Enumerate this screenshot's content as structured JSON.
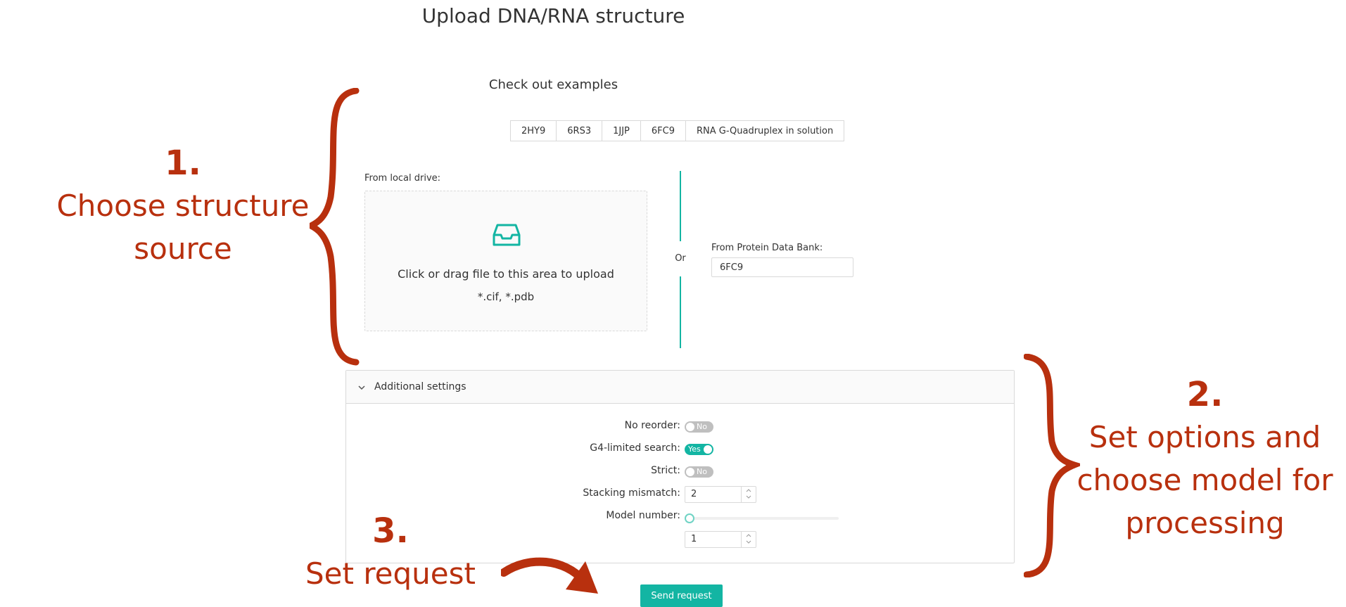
{
  "page": {
    "title": "Upload DNA/RNA structure"
  },
  "examples": {
    "title": "Check out examples",
    "buttons": [
      "2HY9",
      "6RS3",
      "1JJP",
      "6FC9",
      "RNA G-Quadruplex in solution"
    ]
  },
  "upload": {
    "local_label": "From local drive:",
    "drop_text": "Click or drag file to this area to upload",
    "drop_hint": "*.cif, *.pdb",
    "or_label": "Or",
    "pdb_label": "From Protein Data Bank:",
    "pdb_value": "6FC9",
    "icon": "inbox-icon"
  },
  "settings": {
    "title": "Additional settings",
    "no_reorder": {
      "label": "No reorder:",
      "state": "No"
    },
    "g4_limited": {
      "label": "G4-limited search:",
      "state": "Yes"
    },
    "strict": {
      "label": "Strict:",
      "state": "No"
    },
    "stacking_mismatch": {
      "label": "Stacking mismatch:",
      "value": "2"
    },
    "model_number": {
      "label": "Model number:",
      "value": "1",
      "slider_fraction": 0
    }
  },
  "actions": {
    "send_label": "Send request"
  },
  "annotations": {
    "step1": {
      "number": "1.",
      "lines": [
        "Choose structure",
        "source"
      ]
    },
    "step2": {
      "number": "2.",
      "lines": [
        "Set options and",
        "choose model for",
        "processing"
      ]
    },
    "step3": {
      "number": "3.",
      "lines": [
        "Set request"
      ]
    }
  },
  "colors": {
    "accent": "#13b5a3",
    "annotation": "#b8300e",
    "border": "#d9d9d9"
  }
}
